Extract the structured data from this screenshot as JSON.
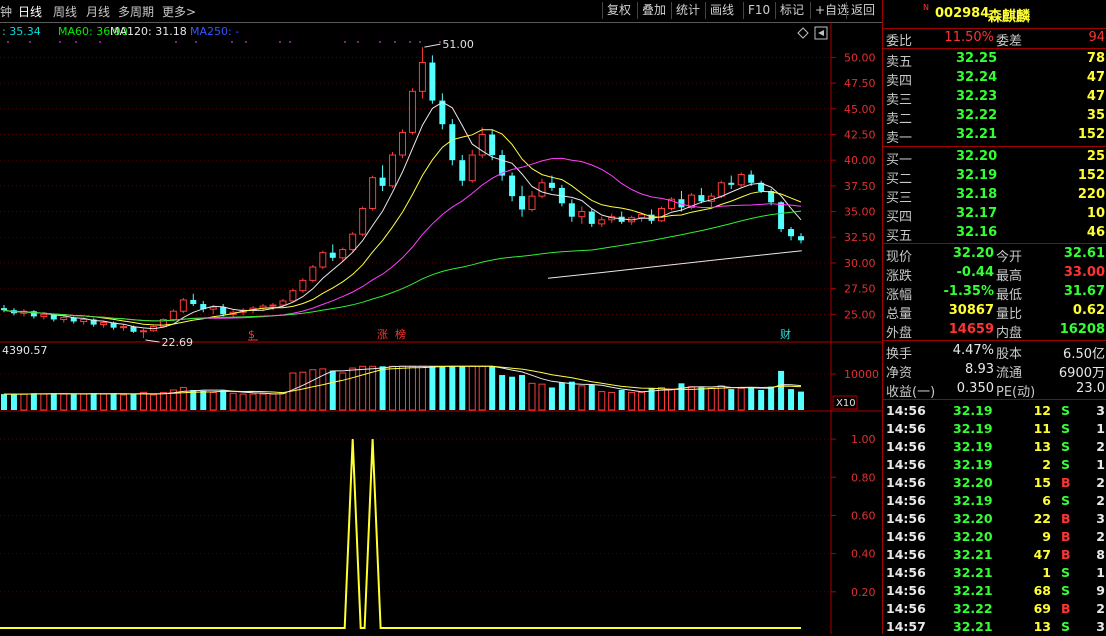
{
  "toolbar": {
    "tabs": [
      "钟",
      "日线",
      "周线",
      "月线",
      "多周期",
      "更多>"
    ],
    "buttons": [
      "复权",
      "叠加",
      "统计",
      "画线",
      "F10",
      "标记",
      "+自选",
      "返回"
    ]
  },
  "ma_legend": [
    {
      "label": ": 35.34",
      "color": "#00dddd"
    },
    {
      "label": "MA60: 36.90",
      "color": "#00ee00"
    },
    {
      "label": "MA120: 31.18",
      "color": "#e8e8e8"
    },
    {
      "label": "MA250: -",
      "color": "#3355ff"
    }
  ],
  "price_axis": {
    "ticks": [
      "50.00",
      "47.50",
      "45.00",
      "42.50",
      "40.00",
      "37.50",
      "35.00",
      "32.50",
      "30.00",
      "27.50",
      "25.00"
    ],
    "min": 22.5,
    "max": 51.5
  },
  "price_annotations": {
    "high": "51.00",
    "low": "22.69"
  },
  "event_markers": [
    {
      "text": "$",
      "color": "#ff3333"
    },
    {
      "text": "涨",
      "color": "#ff3333"
    },
    {
      "text": "榜",
      "color": "#ff3333"
    },
    {
      "text": "财",
      "color": "#33dddd"
    }
  ],
  "volume": {
    "label": "4390.57",
    "tick": "10000",
    "scale": "X10"
  },
  "indicator_axis": {
    "ticks": [
      "1.00",
      "0.80",
      "0.60",
      "0.40",
      "0.20"
    ]
  },
  "chart_data": [
    {
      "type": "candlestick",
      "ylim": [
        22.5,
        51.5
      ],
      "ohlc_approx": [
        [
          25.6,
          25.9,
          25.2,
          25.4
        ],
        [
          25.4,
          25.6,
          24.9,
          25.1
        ],
        [
          25.1,
          25.5,
          24.8,
          25.3
        ],
        [
          25.3,
          25.4,
          24.6,
          24.8
        ],
        [
          24.8,
          25.2,
          24.5,
          25.0
        ],
        [
          25.0,
          25.1,
          24.3,
          24.5
        ],
        [
          24.5,
          24.9,
          24.2,
          24.7
        ],
        [
          24.7,
          24.8,
          24.1,
          24.3
        ],
        [
          24.3,
          24.7,
          24.0,
          24.5
        ],
        [
          24.5,
          24.6,
          23.8,
          24.0
        ],
        [
          24.0,
          24.4,
          23.7,
          24.2
        ],
        [
          24.2,
          24.3,
          23.5,
          23.7
        ],
        [
          23.7,
          24.0,
          23.4,
          23.8
        ],
        [
          23.8,
          23.9,
          23.2,
          23.3
        ],
        [
          23.3,
          23.6,
          22.69,
          23.4
        ],
        [
          23.4,
          23.9,
          23.3,
          23.8
        ],
        [
          23.8,
          24.6,
          23.7,
          24.5
        ],
        [
          24.5,
          25.5,
          24.3,
          25.3
        ],
        [
          25.3,
          26.6,
          25.1,
          26.4
        ],
        [
          26.4,
          27.0,
          25.8,
          26.0
        ],
        [
          26.0,
          26.3,
          25.2,
          25.5
        ],
        [
          25.5,
          25.9,
          25.0,
          25.7
        ],
        [
          25.7,
          26.0,
          24.8,
          25.0
        ],
        [
          25.0,
          25.4,
          24.6,
          25.2
        ],
        [
          25.2,
          25.6,
          24.9,
          25.4
        ],
        [
          25.4,
          25.8,
          25.1,
          25.6
        ],
        [
          25.6,
          26.0,
          25.3,
          25.8
        ],
        [
          25.8,
          26.1,
          25.4,
          25.9
        ],
        [
          25.9,
          26.5,
          25.7,
          26.3
        ],
        [
          26.3,
          27.5,
          26.2,
          27.3
        ],
        [
          27.3,
          28.5,
          27.1,
          28.3
        ],
        [
          28.3,
          29.8,
          28.1,
          29.6
        ],
        [
          29.6,
          31.2,
          29.4,
          31.0
        ],
        [
          31.0,
          31.8,
          30.2,
          30.5
        ],
        [
          30.5,
          31.5,
          30.2,
          31.3
        ],
        [
          31.3,
          33.0,
          31.1,
          32.8
        ],
        [
          32.8,
          35.5,
          32.6,
          35.3
        ],
        [
          35.3,
          38.5,
          35.1,
          38.3
        ],
        [
          38.3,
          39.5,
          37.0,
          37.5
        ],
        [
          37.5,
          40.8,
          37.3,
          40.5
        ],
        [
          40.5,
          43.0,
          40.2,
          42.7
        ],
        [
          42.7,
          47.0,
          42.5,
          46.7
        ],
        [
          46.7,
          51.0,
          46.0,
          49.5
        ],
        [
          49.5,
          50.2,
          45.5,
          45.8
        ],
        [
          45.8,
          46.5,
          43.0,
          43.5
        ],
        [
          43.5,
          44.0,
          39.5,
          40.0
        ],
        [
          40.0,
          40.5,
          37.5,
          38.0
        ],
        [
          38.0,
          41.0,
          37.8,
          40.5
        ],
        [
          40.5,
          43.2,
          40.2,
          42.5
        ],
        [
          42.5,
          43.0,
          40.0,
          40.5
        ],
        [
          40.5,
          41.0,
          38.0,
          38.5
        ],
        [
          38.5,
          38.8,
          36.0,
          36.5
        ],
        [
          36.5,
          37.5,
          34.5,
          35.2
        ],
        [
          35.2,
          37.0,
          35.0,
          36.5
        ],
        [
          36.5,
          38.2,
          36.3,
          37.8
        ],
        [
          37.8,
          38.5,
          37.0,
          37.3
        ],
        [
          37.3,
          37.6,
          35.5,
          35.8
        ],
        [
          35.8,
          36.2,
          34.0,
          34.5
        ],
        [
          34.5,
          35.5,
          33.8,
          35.0
        ],
        [
          35.0,
          35.3,
          33.5,
          33.8
        ],
        [
          33.8,
          34.5,
          33.5,
          34.2
        ],
        [
          34.2,
          34.8,
          33.9,
          34.5
        ],
        [
          34.5,
          35.0,
          33.8,
          34.0
        ],
        [
          34.0,
          34.6,
          33.7,
          34.4
        ],
        [
          34.4,
          34.9,
          34.0,
          34.7
        ],
        [
          34.7,
          35.2,
          33.8,
          34.1
        ],
        [
          34.1,
          35.5,
          34.0,
          35.3
        ],
        [
          35.3,
          36.4,
          35.1,
          36.2
        ],
        [
          36.2,
          37.0,
          35.0,
          35.4
        ],
        [
          35.4,
          36.8,
          35.2,
          36.6
        ],
        [
          36.6,
          37.3,
          35.8,
          36.0
        ],
        [
          36.0,
          36.8,
          35.4,
          36.5
        ],
        [
          36.5,
          38.0,
          36.3,
          37.8
        ],
        [
          37.8,
          38.5,
          37.2,
          37.6
        ],
        [
          37.6,
          38.8,
          37.4,
          38.6
        ],
        [
          38.6,
          39.0,
          37.5,
          37.8
        ],
        [
          37.8,
          38.0,
          36.8,
          37.0
        ],
        [
          37.0,
          37.2,
          35.6,
          35.9
        ],
        [
          35.9,
          36.0,
          33.0,
          33.3
        ],
        [
          33.3,
          33.5,
          32.2,
          32.6
        ],
        [
          32.6,
          32.9,
          31.9,
          32.2
        ]
      ]
    },
    {
      "type": "bar",
      "series": [
        {
          "name": "volume"
        }
      ]
    },
    {
      "type": "line",
      "ylim": [
        0,
        1.1
      ]
    }
  ],
  "quote": {
    "code": "002984",
    "name": "森麒麟",
    "webi_label": "委比",
    "webi": "11.50%",
    "weicha_label": "委差",
    "weicha": "94",
    "asks": [
      {
        "label": "卖五",
        "price": "32.25",
        "vol": "78"
      },
      {
        "label": "卖四",
        "price": "32.24",
        "vol": "47"
      },
      {
        "label": "卖三",
        "price": "32.23",
        "vol": "47"
      },
      {
        "label": "卖二",
        "price": "32.22",
        "vol": "35"
      },
      {
        "label": "卖一",
        "price": "32.21",
        "vol": "152"
      }
    ],
    "bids": [
      {
        "label": "买一",
        "price": "32.20",
        "vol": "25"
      },
      {
        "label": "买二",
        "price": "32.19",
        "vol": "152"
      },
      {
        "label": "买三",
        "price": "32.18",
        "vol": "220"
      },
      {
        "label": "买四",
        "price": "32.17",
        "vol": "10"
      },
      {
        "label": "买五",
        "price": "32.16",
        "vol": "46"
      }
    ],
    "stats": [
      {
        "l1": "现价",
        "v1": "32.20",
        "c1": "grn",
        "l2": "今开",
        "v2": "32.61",
        "c2": "grn"
      },
      {
        "l1": "涨跌",
        "v1": "-0.44",
        "c1": "grn",
        "l2": "最高",
        "v2": "33.00",
        "c2": "red"
      },
      {
        "l1": "涨幅",
        "v1": "-1.35%",
        "c1": "grn",
        "l2": "最低",
        "v2": "31.67",
        "c2": "grn"
      },
      {
        "l1": "总量",
        "v1": "30867",
        "c1": "yel",
        "l2": "量比",
        "v2": "0.62",
        "c2": "yel"
      },
      {
        "l1": "外盘",
        "v1": "14659",
        "c1": "red",
        "l2": "内盘",
        "v2": "16208",
        "c2": "grn"
      }
    ],
    "stats2": [
      {
        "l1": "换手",
        "v1": "4.47%",
        "l2": "股本",
        "v2": "6.50亿"
      },
      {
        "l1": "净资",
        "v1": "8.93",
        "l2": "流通",
        "v2": "6900万"
      },
      {
        "l1": "收益(一)",
        "v1": "0.350",
        "l2": "PE(动)",
        "v2": "23.0"
      }
    ],
    "ticks": [
      {
        "t": "14:56",
        "p": "32.19",
        "v": "12",
        "s": "S",
        "n": "3"
      },
      {
        "t": "14:56",
        "p": "32.19",
        "v": "11",
        "s": "S",
        "n": "1"
      },
      {
        "t": "14:56",
        "p": "32.19",
        "v": "13",
        "s": "S",
        "n": "2"
      },
      {
        "t": "14:56",
        "p": "32.19",
        "v": "2",
        "s": "S",
        "n": "1"
      },
      {
        "t": "14:56",
        "p": "32.20",
        "v": "15",
        "s": "B",
        "n": "2"
      },
      {
        "t": "14:56",
        "p": "32.19",
        "v": "6",
        "s": "S",
        "n": "2"
      },
      {
        "t": "14:56",
        "p": "32.20",
        "v": "22",
        "s": "B",
        "n": "3"
      },
      {
        "t": "14:56",
        "p": "32.20",
        "v": "9",
        "s": "B",
        "n": "2"
      },
      {
        "t": "14:56",
        "p": "32.21",
        "v": "47",
        "s": "B",
        "n": "8"
      },
      {
        "t": "14:56",
        "p": "32.21",
        "v": "1",
        "s": "S",
        "n": "1"
      },
      {
        "t": "14:56",
        "p": "32.21",
        "v": "68",
        "s": "S",
        "n": "9"
      },
      {
        "t": "14:56",
        "p": "32.22",
        "v": "69",
        "s": "B",
        "n": "2"
      },
      {
        "t": "14:57",
        "p": "32.21",
        "v": "13",
        "s": "S",
        "n": "3"
      }
    ]
  }
}
